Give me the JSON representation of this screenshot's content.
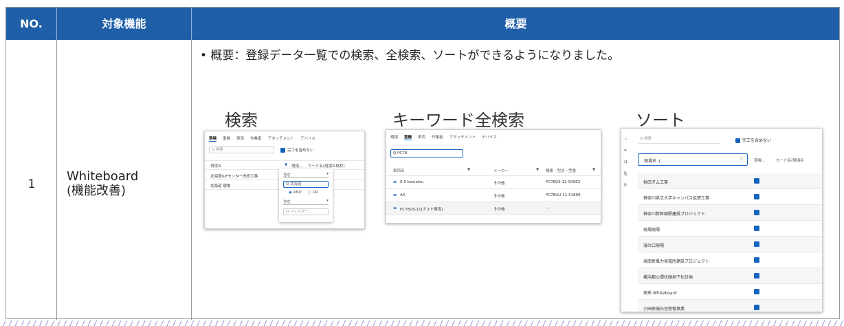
{
  "header": {
    "no": "NO.",
    "feature": "対象機能",
    "overview": "概要"
  },
  "row": {
    "no": "1",
    "feature": "Whiteboard\n(機能改善)",
    "description": "• 概要：登録データ一覧での検索、全検索、ソートができるようになりました。"
  },
  "sections": {
    "search": {
      "title": "検索",
      "tabs": [
        "現場",
        "重機",
        "車両",
        "作業者",
        "アタッチメント",
        "デバイス"
      ],
      "search_placeholder": "Q 検索",
      "checkbox_label": "完工を含めない",
      "col_headers": [
        "現場名",
        "現場...",
        "カード名(現場名略称)"
      ],
      "rows": [
        "北海道tuFセンター改修工事",
        "北海道 現場"
      ],
      "filter": {
        "op1": "含む",
        "value": "Q 北海道",
        "and": "AND",
        "or": "OR",
        "op2": "含む",
        "placeholder": "Q フィルター..."
      }
    },
    "fulltext": {
      "title": "キーワード全検索",
      "tabs": [
        "現場",
        "重機",
        "車両",
        "作業者",
        "アタッチメント",
        "デバイス"
      ],
      "search_value": "Q PC78",
      "col_headers": [
        "車両名",
        "メーカー",
        "規格・型式・型番"
      ],
      "rows": [
        {
          "name": "0.5-komatsu",
          "maker": "その他",
          "model": "PC78US-11-50963"
        },
        {
          "name": "A4",
          "maker": "その他",
          "model": "PC78UU-11-51899"
        },
        {
          "name": "PC78US-11(テスト車両)",
          "maker": "その他",
          "model": "---"
        }
      ]
    },
    "sort": {
      "title": "ソート",
      "search_placeholder": "Q 検索",
      "checkbox_label": "完工を含めない",
      "col_headers": [
        "現場名 ↓",
        "現場...",
        "カード名(現場名"
      ],
      "rows": [
        "秋田ダム工事",
        "神奈川県立大学キャンパス拡張工事",
        "神奈川新幹線駅建設プロジェクト",
        "現場現場",
        "滝の口現場",
        "湘南新風力発電所建設プロジェクト",
        "横浜都心環状線地下化計画",
        "琉季 Whiteboard",
        "小田原城石垣修復事業"
      ]
    }
  },
  "colors": {
    "header_bg": "#1e5fa8",
    "accent": "#1565c0"
  }
}
